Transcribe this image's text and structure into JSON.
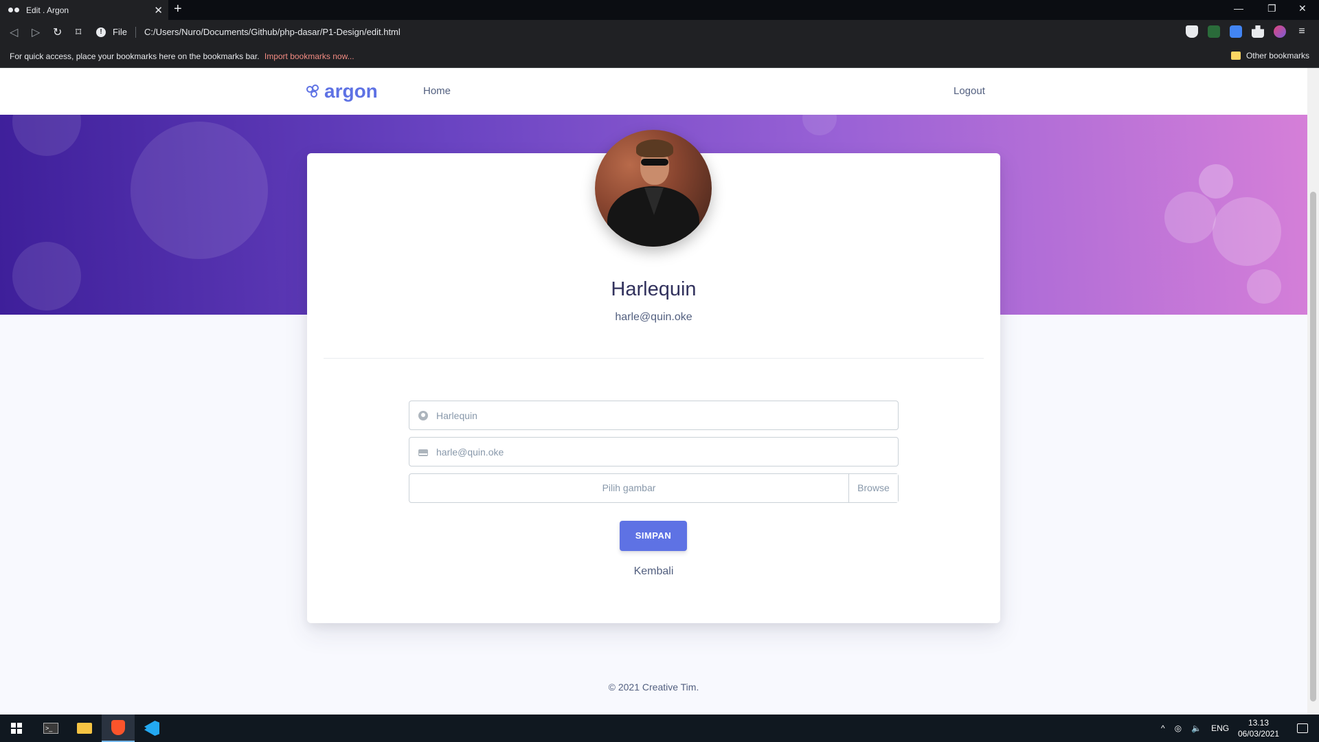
{
  "browser": {
    "tab_title": "Edit . Argon",
    "url_scheme": "File",
    "url": "C:/Users/Nuro/Documents/Github/php-dasar/P1-Design/edit.html",
    "bookmarks_message": "For quick access, place your bookmarks here on the bookmarks bar.",
    "bookmarks_import": "Import bookmarks now...",
    "other_bookmarks": "Other bookmarks"
  },
  "navbar": {
    "brand": "argon",
    "home": "Home",
    "logout": "Logout"
  },
  "profile": {
    "name": "Harlequin",
    "email": "harle@quin.oke"
  },
  "form": {
    "name_value": "Harlequin",
    "email_value": "harle@quin.oke",
    "file_placeholder": "Pilih gambar",
    "browse_label": "Browse",
    "submit_label": "SIMPAN",
    "back_label": "Kembali"
  },
  "footer": {
    "copyright": "© 2021 Creative Tim."
  },
  "taskbar": {
    "language": "ENG",
    "time": "13.13",
    "date": "06/03/2021"
  },
  "colors": {
    "primary": "#5e72e4",
    "hero_start": "#3e1f9a",
    "hero_end": "#d57fd8",
    "text_heading": "#32325d"
  }
}
